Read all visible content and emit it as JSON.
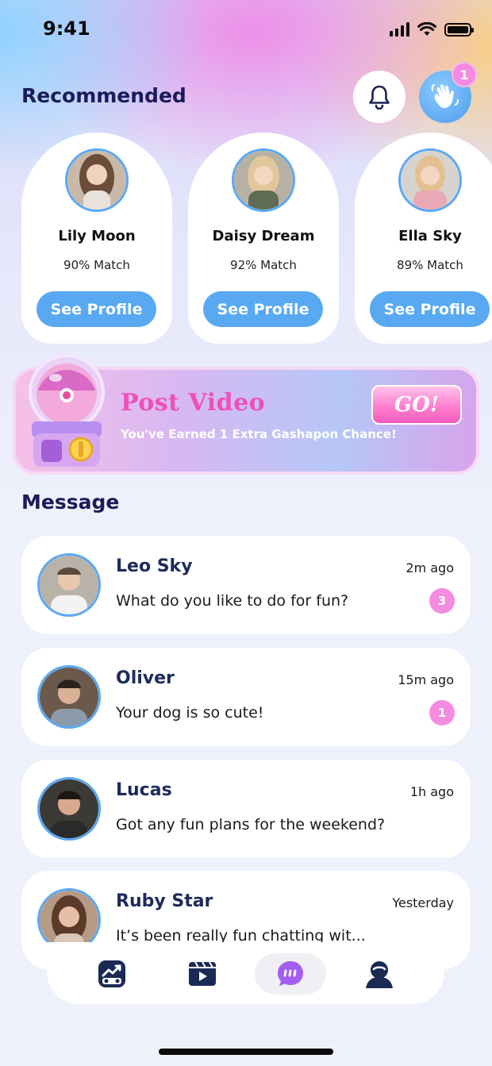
{
  "status": {
    "time": "9:41"
  },
  "header": {
    "recommended_title": "Recommended",
    "wave_badge": "1"
  },
  "recommended": [
    {
      "name": "Lily Moon",
      "match": "90% Match",
      "button": "See Profile",
      "avatar_color": "#8a6a52"
    },
    {
      "name": "Daisy Dream",
      "match": "92% Match",
      "button": "See Profile",
      "avatar_color": "#d2b48c"
    },
    {
      "name": "Ella Sky",
      "match": "89% Match",
      "button": "See Profile",
      "avatar_color": "#e7c29a"
    }
  ],
  "banner": {
    "title": "Post Video",
    "subtitle": "You've Earned 1 Extra Gashapon Chance!",
    "button": "GO!"
  },
  "messages_section": {
    "title": "Message"
  },
  "messages": [
    {
      "name": "Leo Sky",
      "time": "2m ago",
      "text": "What do you like to do for fun?",
      "unread": "3",
      "avatar_color": "#b9b2a8"
    },
    {
      "name": "Oliver",
      "time": "15m ago",
      "text": "Your dog is so cute!",
      "unread": "1",
      "avatar_color": "#6b5a4c"
    },
    {
      "name": "Lucas",
      "time": "1h ago",
      "text": "Got any fun plans for the weekend?",
      "unread": "",
      "avatar_color": "#3c3a36"
    },
    {
      "name": "Ruby Star",
      "time": "Yesterday",
      "text": "It’s been really fun chatting wit...",
      "unread": "",
      "avatar_color": "#8d6652"
    }
  ],
  "tabs": [
    {
      "name": "tab-match",
      "icon": "match-icon",
      "active": false
    },
    {
      "name": "tab-video",
      "icon": "video-icon",
      "active": false
    },
    {
      "name": "tab-messages",
      "icon": "chat-icon",
      "active": true
    },
    {
      "name": "tab-profile",
      "icon": "profile-icon",
      "active": false
    }
  ],
  "colors": {
    "accent_blue": "#58a9f1",
    "badge_pink": "#f48be0",
    "active_chat": "#a35ef0",
    "navy": "#1b2a55"
  }
}
